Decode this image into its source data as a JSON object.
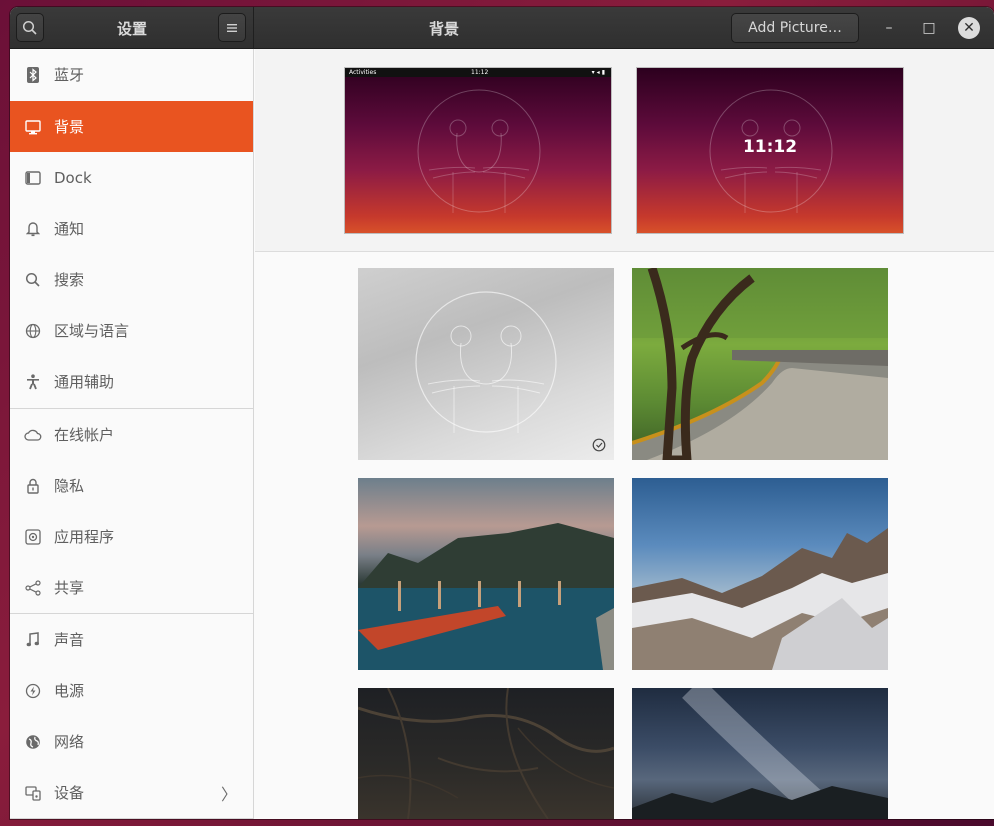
{
  "header": {
    "sidebar_title": "设置",
    "page_title": "背景",
    "add_picture_label": "Add Picture…",
    "minimize_glyph": "–",
    "maximize_glyph": "□",
    "close_glyph": "✕"
  },
  "sidebar": {
    "items": [
      {
        "label": "蓝牙",
        "icon": "bluetooth-icon"
      },
      {
        "label": "背景",
        "icon": "background-icon",
        "active": true
      },
      {
        "label": "Dock",
        "icon": "dock-icon"
      },
      {
        "label": "通知",
        "icon": "bell-icon"
      },
      {
        "label": "搜索",
        "icon": "search-icon"
      },
      {
        "label": "区域与语言",
        "icon": "globe-icon"
      },
      {
        "label": "通用辅助",
        "icon": "accessibility-icon"
      },
      {
        "label": "在线帐户",
        "icon": "cloud-icon"
      },
      {
        "label": "隐私",
        "icon": "lock-icon"
      },
      {
        "label": "应用程序",
        "icon": "apps-icon"
      },
      {
        "label": "共享",
        "icon": "share-icon"
      },
      {
        "label": "声音",
        "icon": "music-icon"
      },
      {
        "label": "电源",
        "icon": "power-icon"
      },
      {
        "label": "网络",
        "icon": "network-icon"
      },
      {
        "label": "设备",
        "icon": "devices-icon"
      }
    ],
    "arrow": "〉"
  },
  "previews": {
    "desktop": {
      "activities": "Activities",
      "time": "11:12"
    },
    "lock": {
      "time": "11:12"
    }
  },
  "colors": {
    "accent": "#e95420",
    "headerbar": "#333333"
  }
}
